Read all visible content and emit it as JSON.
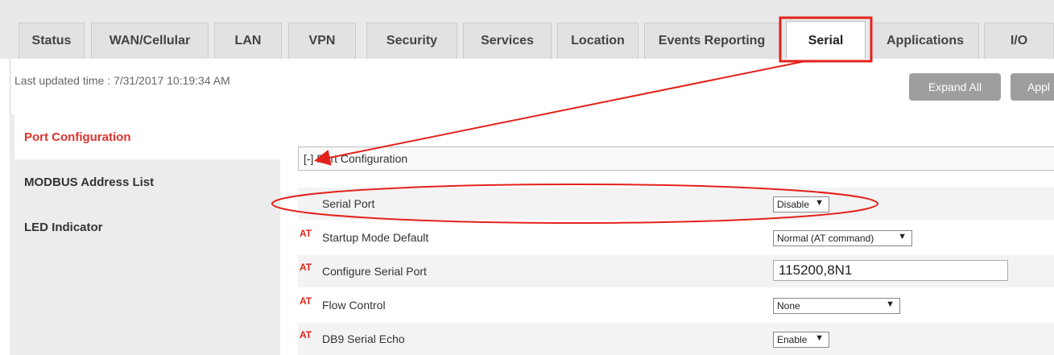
{
  "tabs": [
    "Status",
    "WAN/Cellular",
    "LAN",
    "VPN",
    "Security",
    "Services",
    "Location",
    "Events Reporting",
    "Serial",
    "Applications",
    "I/O"
  ],
  "active_tab": "Serial",
  "last_updated": "Last updated time : 7/31/2017 10:19:34 AM",
  "buttons": {
    "expand_all": "Expand All",
    "apply": "Appl"
  },
  "sidebar": {
    "items": [
      {
        "label": "Port Configuration"
      },
      {
        "label": "MODBUS Address List"
      },
      {
        "label": "LED Indicator"
      }
    ]
  },
  "section": {
    "title": "[-] Port Configuration"
  },
  "at_badge": "AT",
  "rows": [
    {
      "label": "Serial Port",
      "at": false,
      "control": "select",
      "value": "Disable"
    },
    {
      "label": "Startup Mode Default",
      "at": true,
      "control": "select",
      "value": "Normal (AT command)"
    },
    {
      "label": "Configure Serial Port",
      "at": true,
      "control": "text",
      "value": "115200,8N1"
    },
    {
      "label": "Flow Control",
      "at": true,
      "control": "select",
      "value": "None"
    },
    {
      "label": "DB9 Serial Echo",
      "at": true,
      "control": "select",
      "value": "Enable"
    }
  ],
  "dropdown_arrow": "▼",
  "colors": {
    "highlight": "#e3221b",
    "active_nav": "#e0322c",
    "button": "#9e9e9e"
  }
}
